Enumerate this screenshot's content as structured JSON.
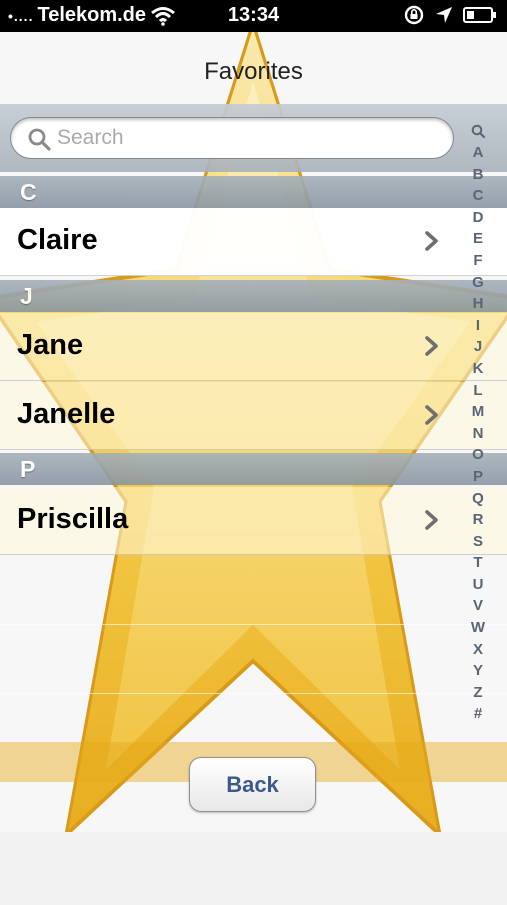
{
  "status_bar": {
    "signal_dots": "•....",
    "carrier": "Telekom.de",
    "time": "13:34",
    "icons": [
      "wifi-icon",
      "rotation-lock-icon",
      "location-icon",
      "battery-icon"
    ]
  },
  "header": {
    "title": "Favorites"
  },
  "search": {
    "placeholder": "Search"
  },
  "sections": [
    {
      "letter": "C",
      "contacts": [
        "Claire"
      ]
    },
    {
      "letter": "J",
      "contacts": [
        "Jane",
        "Janelle"
      ]
    },
    {
      "letter": "P",
      "contacts": [
        "Priscilla"
      ]
    }
  ],
  "index_letters": [
    "A",
    "B",
    "C",
    "D",
    "E",
    "F",
    "G",
    "H",
    "I",
    "J",
    "K",
    "L",
    "M",
    "N",
    "O",
    "P",
    "Q",
    "R",
    "S",
    "T",
    "U",
    "V",
    "W",
    "X",
    "Y",
    "Z",
    "#"
  ],
  "back_button": "Back",
  "colors": {
    "star_gold": "#f2c23a",
    "section_header": "#96a1ac",
    "back_text": "#3b5b8c"
  }
}
